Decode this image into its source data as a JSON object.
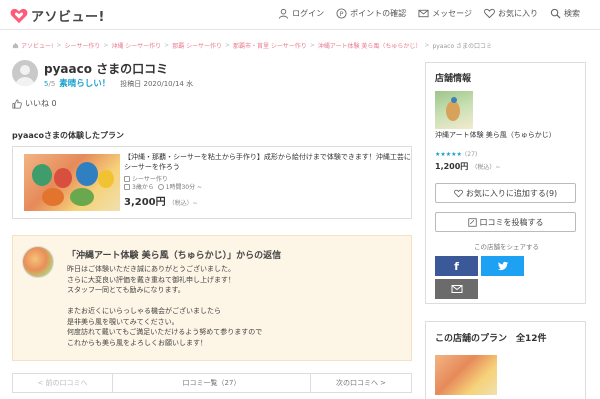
{
  "header": {
    "logo_text": "アソビュー!",
    "brand_color": "#ff5a78",
    "nav": [
      {
        "label": "ログイン",
        "icon": "person-icon"
      },
      {
        "label": "ポイントの確認",
        "icon": "point-icon"
      },
      {
        "label": "メッセージ",
        "icon": "mail-icon"
      },
      {
        "label": "お気に入り",
        "icon": "heart-icon"
      },
      {
        "label": "検索",
        "icon": "search-icon"
      }
    ]
  },
  "breadcrumb": [
    "アソビュー!",
    "シーサー作り",
    "沖縄 シーサー作り",
    "那覇 シーサー作り",
    "那覇市・首里 シーサー作り",
    "沖縄アート体験 美ら風（ちゅらかじ）",
    "pyaaco さまの口コミ"
  ],
  "review": {
    "reviewer": "pyaaco さまの口コミ",
    "score": "5",
    "score_max": "/5",
    "rating_label": "素晴らしい！",
    "posted": "投稿日 2020/10/14 水",
    "like_label": "いいね 0"
  },
  "plan": {
    "section_title": "pyaacoさまの体験したプラン",
    "title": "【沖縄・那覇・シーサーを粘土から手作り】成形から絵付けまで体験できます！沖縄工芸にシーサーを作ろう",
    "category": "シーサー作り",
    "age": "3歳から",
    "duration": "1時間30分 ~",
    "price": "3,200円",
    "price_note": "（税込）~"
  },
  "reply": {
    "title": "「沖縄アート体験 美ら風（ちゅらかじ）」からの返信",
    "body": "昨日はご体験いただき誠にありがとうございました。\nさらに大変良い評価を戴き重ねて御礼申し上げます！\nスタッフ一同とても励みになります。\n\nまたお近くにいらっしゃる機会がございましたら\n是非美ら風を覗いてみてください。\n何度訪れて戴いてもご満足いただけるよう努めて参りますので\nこれからも美ら風をよろしくお願いします！"
  },
  "pager": {
    "prev": "< 前の口コミへ",
    "list": "口コミ一覧（27）",
    "next": "次の口コミへ >"
  },
  "shop": {
    "title": "店舗情報",
    "name": "沖縄アート体験 美ら風（ちゅらかじ）",
    "stars": "★★★★★",
    "review_count": "(27)",
    "price": "1,200円",
    "price_note": "（税込）~",
    "fav_button": "お気に入りに追加する(9)",
    "post_button": "口コミを投稿する",
    "share_label": "この店舗をシェアする",
    "facebook": "f"
  },
  "plans": {
    "title": "この店舗のプラン　全12件"
  },
  "colors": {
    "accent_blue": "#1a9fd0",
    "reply_bg": "#fdf5e6",
    "facebook": "#3b5998",
    "twitter": "#1da1f2"
  }
}
